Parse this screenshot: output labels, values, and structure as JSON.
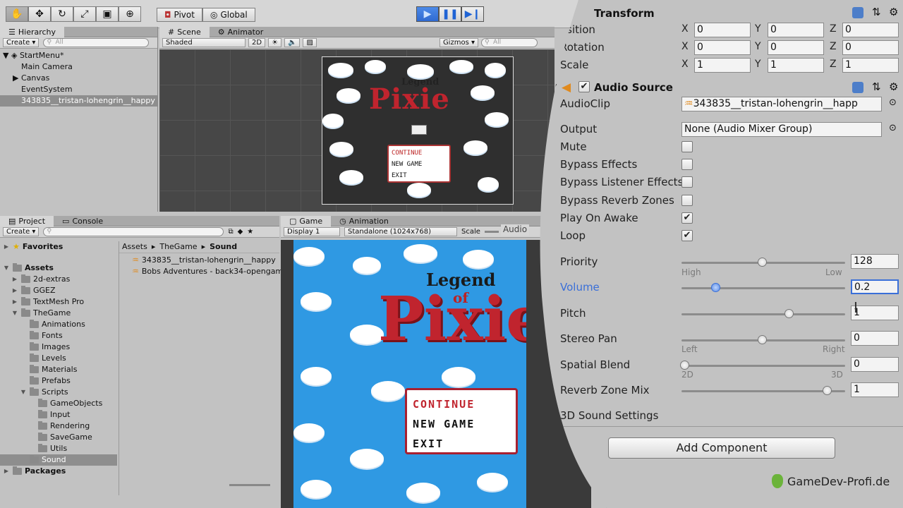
{
  "toolbar": {
    "pivot_label": "Pivot",
    "global_label": "Global"
  },
  "hierarchy": {
    "tab": "Hierarchy",
    "create": "Create ▾",
    "search_placeholder": "All",
    "scene_name": "StartMenu*",
    "items": [
      "Main Camera",
      "Canvas",
      "EventSystem",
      "343835__tristan-lohengrin__happy"
    ]
  },
  "scene": {
    "tab": "Scene",
    "animator_tab": "Animator",
    "shading": "Shaded",
    "mode_2d": "2D",
    "gizmos": "Gizmos ▾",
    "search_placeholder": "All"
  },
  "game_menu": {
    "title_small": "Legend",
    "title_of": "of",
    "title_big": "Pixie",
    "options": [
      "CONTINUE",
      "NEW GAME",
      "EXIT"
    ]
  },
  "project": {
    "tab": "Project",
    "console_tab": "Console",
    "create": "Create ▾",
    "favorites": "Favorites",
    "assets": "Assets",
    "packages": "Packages",
    "breadcrumb": [
      "Assets",
      "TheGame",
      "Sound"
    ],
    "files": [
      "343835__tristan-lohengrin__happy",
      "Bobs Adventures - back34-opengam"
    ]
  },
  "game": {
    "tab": "Game",
    "animation_tab": "Animation",
    "display": "Display 1",
    "resolution": "Standalone (1024x768)",
    "scale_label": "Scale",
    "audio_tab": "Audio"
  },
  "inspector": {
    "transform_title": "Transform",
    "position_label": "osition",
    "rotation_label": "Rotation",
    "scale_label": "Scale",
    "position": {
      "x": "0",
      "y": "0",
      "z": "0"
    },
    "rotation": {
      "x": "0",
      "y": "0",
      "z": "0"
    },
    "scale": {
      "x": "1",
      "y": "1",
      "z": "1"
    },
    "audio_source_title": "Audio Source",
    "audioclip_label": "AudioClip",
    "audioclip_value": "343835__tristan-lohengrin__happ",
    "output_label": "Output",
    "output_value": "None (Audio Mixer Group)",
    "mute_label": "Mute",
    "bypass_effects_label": "Bypass Effects",
    "bypass_listener_label": "Bypass Listener Effects",
    "bypass_reverb_label": "Bypass Reverb Zones",
    "play_on_awake_label": "Play On Awake",
    "loop_label": "Loop",
    "mute": false,
    "bypass_effects": false,
    "bypass_listener": false,
    "bypass_reverb": false,
    "play_on_awake": true,
    "loop": true,
    "priority_label": "Priority",
    "priority_value": "128",
    "priority_high": "High",
    "priority_low": "Low",
    "volume_label": "Volume",
    "volume_value": "0.2",
    "pitch_label": "Pitch",
    "pitch_value": "1",
    "stereo_pan_label": "Stereo Pan",
    "stereo_pan_value": "0",
    "pan_left": "Left",
    "pan_right": "Right",
    "spatial_blend_label": "Spatial Blend",
    "spatial_blend_value": "0",
    "blend_2d": "2D",
    "blend_3d": "3D",
    "reverb_mix_label": "Reverb Zone Mix",
    "reverb_mix_value": "1",
    "sound_settings_label": "3D Sound Settings",
    "add_component": "Add Component",
    "accent_color": "#3a6fd8"
  },
  "watermark": "GameDev-Profi.de"
}
